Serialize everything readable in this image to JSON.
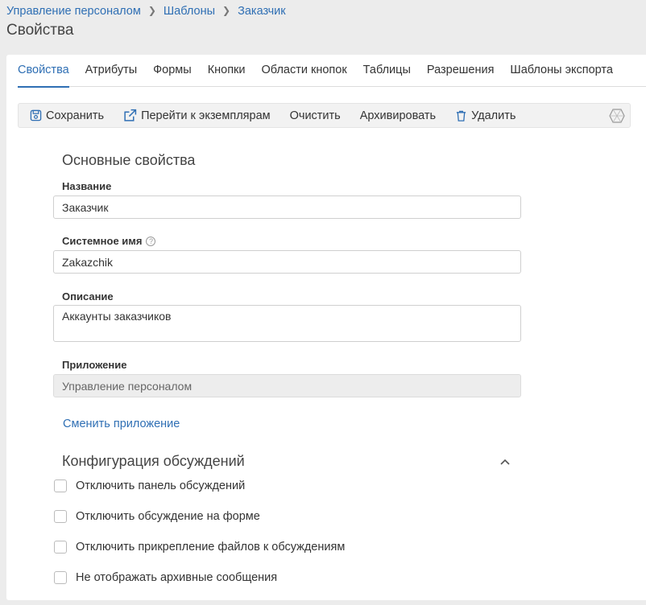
{
  "breadcrumb": [
    "Управление персоналом",
    "Шаблоны",
    "Заказчик"
  ],
  "page_title": "Свойства",
  "tabs": [
    {
      "label": "Свойства",
      "active": true
    },
    {
      "label": "Атрибуты"
    },
    {
      "label": "Формы"
    },
    {
      "label": "Кнопки"
    },
    {
      "label": "Области кнопок"
    },
    {
      "label": "Таблицы"
    },
    {
      "label": "Разрешения"
    },
    {
      "label": "Шаблоны экспорта"
    }
  ],
  "toolbar": {
    "save": "Сохранить",
    "goto_instances": "Перейти к экземплярам",
    "clear": "Очистить",
    "archive": "Архивировать",
    "delete": "Удалить"
  },
  "basic": {
    "title": "Основные свойства",
    "name_label": "Название",
    "name_value": "Заказчик",
    "system_name_label": "Системное имя",
    "system_name_value": "Zakazchik",
    "description_label": "Описание",
    "description_value": "Аккаунты заказчиков",
    "application_label": "Приложение",
    "application_value": "Управление персоналом",
    "change_app_link": "Сменить приложение"
  },
  "discussions": {
    "title": "Конфигурация обсуждений",
    "options": [
      {
        "label": "Отключить панель обсуждений",
        "checked": false
      },
      {
        "label": "Отключить обсуждение на форме",
        "checked": false
      },
      {
        "label": "Отключить прикрепление файлов к обсуждениям",
        "checked": false
      },
      {
        "label": "Не отображать архивные сообщения",
        "checked": false
      }
    ]
  },
  "colors": {
    "accent": "#2f6fb4",
    "background": "#ececec"
  }
}
